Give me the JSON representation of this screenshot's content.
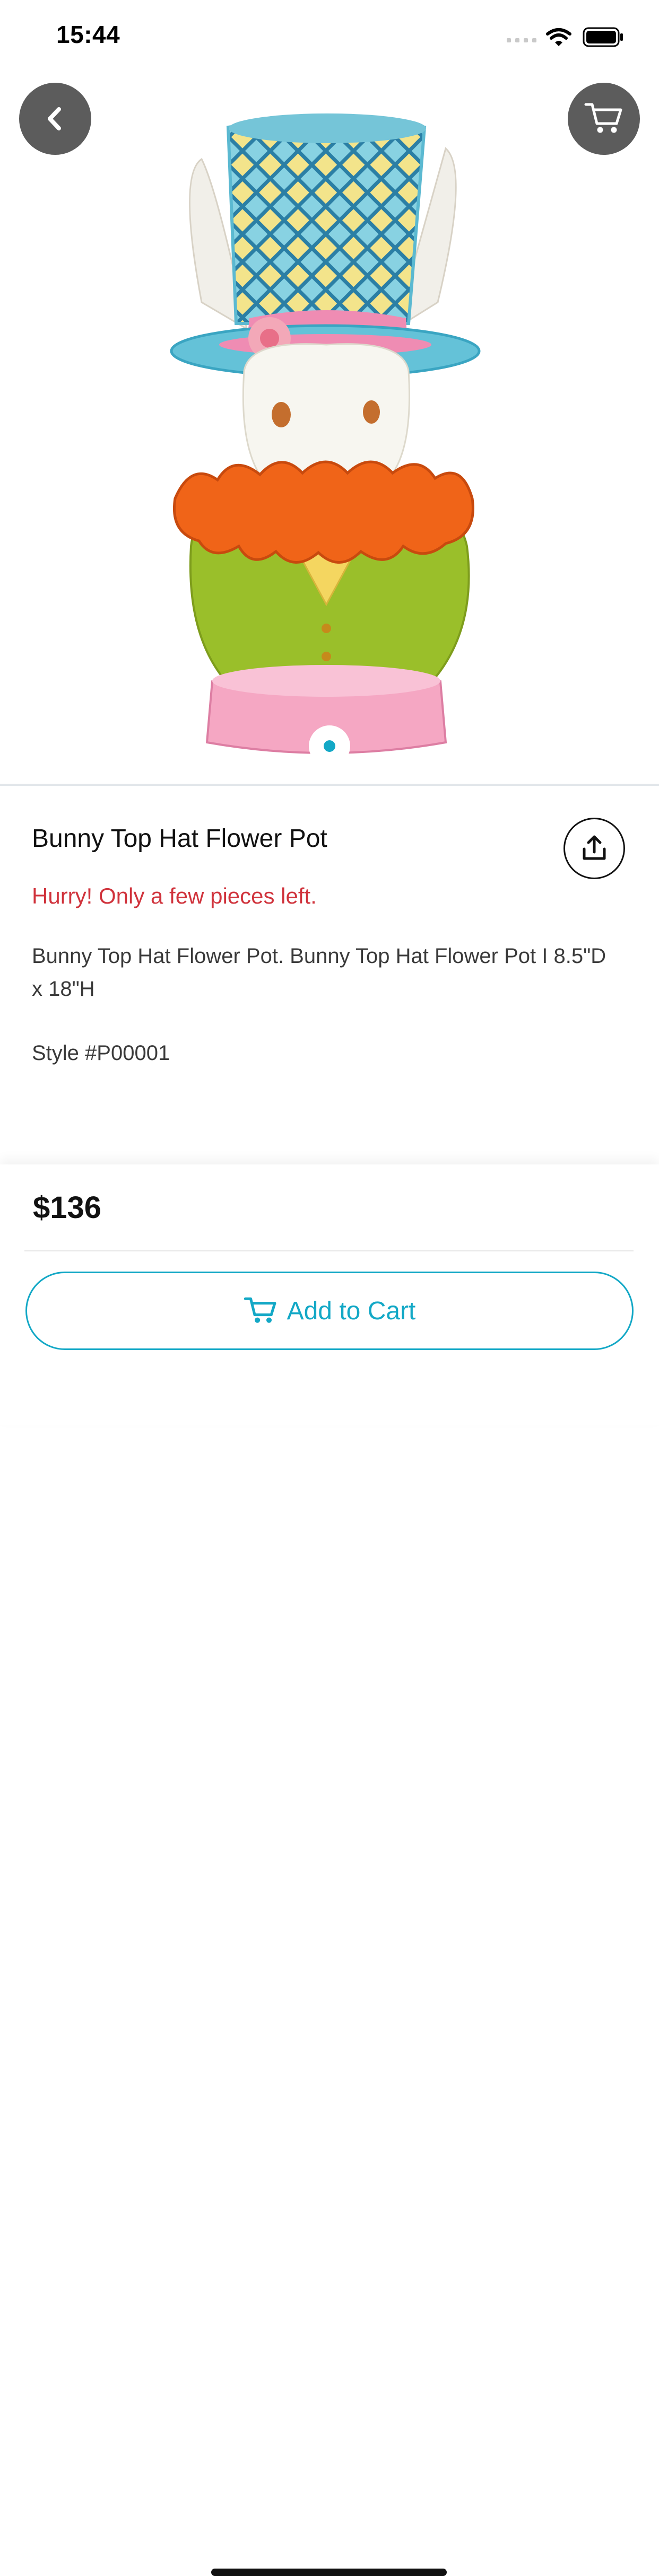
{
  "status_bar": {
    "time": "15:44"
  },
  "product": {
    "title": "Bunny Top Hat Flower Pot",
    "stock_message": "Hurry! Only a few pieces left.",
    "description": "Bunny Top Hat Flower Pot. Bunny Top Hat Flower Pot I 8.5\"D x 18\"H",
    "style": "Style #P00001",
    "price": "$136"
  },
  "actions": {
    "add_to_cart": "Add to Cart"
  },
  "icons": {
    "back": "chevron-left-icon",
    "cart": "cart-icon",
    "share": "share-icon",
    "wifi": "wifi-icon",
    "battery": "battery-icon"
  },
  "carousel": {
    "page_count": 1,
    "active_index": 0
  },
  "colors": {
    "accent": "#13a8c6",
    "warning": "#d0333c",
    "icon_button_bg": "#5c5c5c"
  }
}
